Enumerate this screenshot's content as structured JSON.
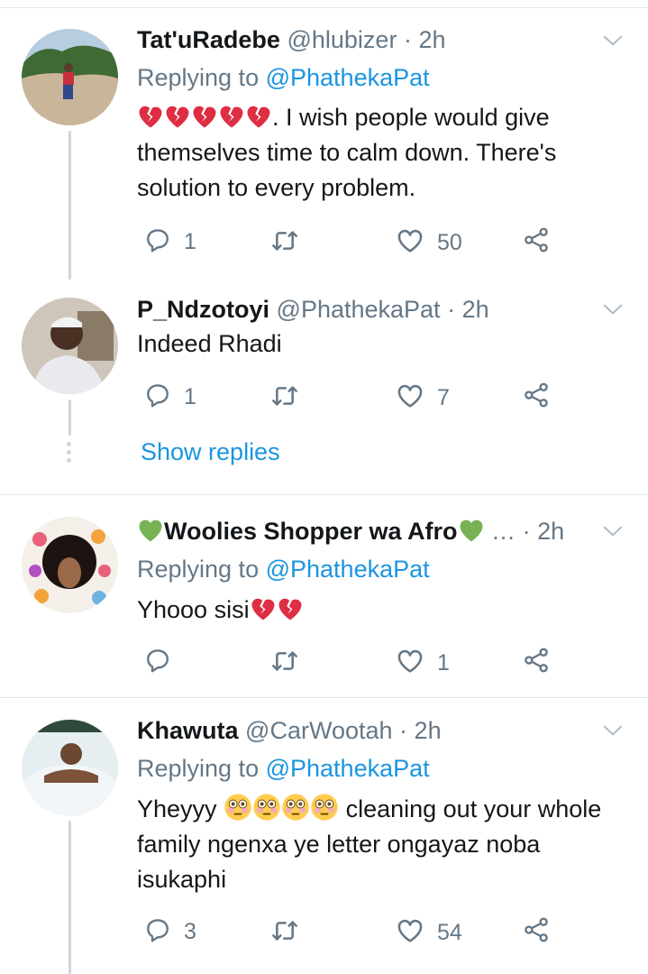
{
  "tweets": [
    {
      "name": "Tat'uRadebe",
      "handle": "@hlubizer",
      "sep": "·",
      "time": "2h",
      "replying_prefix": "Replying to",
      "replying_to": "@PhathekaPat",
      "text": ". I wish people would give themselves time to calm down. There's solution to every problem.",
      "replies": "1",
      "likes": "50"
    },
    {
      "name": "P_Ndzotoyi",
      "handle": "@PhathekaPat",
      "sep": "·",
      "time": "2h",
      "text": "Indeed Rhadi",
      "replies": "1",
      "likes": "7"
    },
    {
      "name": "Woolies Shopper wa Afro",
      "handle": "…",
      "sep": "·",
      "time": "2h",
      "replying_prefix": "Replying to",
      "replying_to": "@PhathekaPat",
      "text": "Yhooo sisi",
      "likes": "1"
    },
    {
      "name": "Khawuta",
      "handle": "@CarWootah",
      "sep": "·",
      "time": "2h",
      "replying_prefix": "Replying to",
      "replying_to": "@PhathekaPat",
      "text_before": "Yheyyy",
      "text_after": "cleaning out your whole family ngenxa ye letter ongayaz noba isukaphi",
      "replies": "3",
      "likes": "54"
    }
  ],
  "show_replies": "Show replies",
  "icons": [
    "chevron-down-icon",
    "reply-icon",
    "retweet-icon",
    "like-icon",
    "share-icon",
    "broken-heart-emoji",
    "green-heart-emoji",
    "flushed-face-emoji"
  ],
  "colors": {
    "link": "#1b95e0",
    "muted": "#657786",
    "divider": "#e1e8ed",
    "heart": "#e0245e",
    "green_heart": "#77b255"
  }
}
